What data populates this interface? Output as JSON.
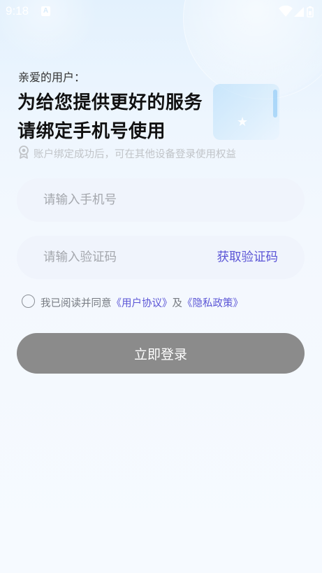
{
  "status_bar": {
    "time": "9:18",
    "notification_icon_letter": "A",
    "icons": [
      "wifi-icon",
      "cellular-signal-icon",
      "battery-icon"
    ]
  },
  "header": {
    "greeting": "亲爱的用户：",
    "title_line1": "为给您提供更好的服务",
    "title_line2": "请绑定手机号使用",
    "tip": "账户绑定成功后，可在其他设备登录使用权益",
    "tip_icon": "badge-icon"
  },
  "form": {
    "phone_placeholder": "请输入手机号",
    "phone_value": "",
    "code_placeholder": "请输入验证码",
    "code_value": "",
    "get_code_label": "获取验证码"
  },
  "agreement": {
    "checked": false,
    "prefix": "我已阅读并同意",
    "user_agreement": "《用户协议》",
    "conjunction": "及",
    "privacy_policy": "《隐私政策》"
  },
  "actions": {
    "login_label": "立即登录"
  },
  "colors": {
    "accent": "#5b55d6",
    "button_disabled": "#8b8b8b",
    "input_bg": "#f0f4fc",
    "background_top": "#e3f1fd"
  }
}
